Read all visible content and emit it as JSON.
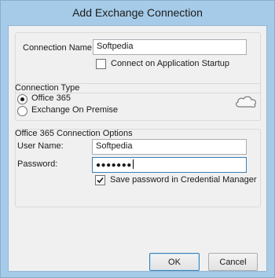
{
  "window": {
    "title": "Add Exchange Connection"
  },
  "connection": {
    "name_label": "Connection Name:",
    "name_value": "Softpedia",
    "startup_label": "Connect on Application Startup",
    "startup_checked": false
  },
  "connection_type": {
    "legend": "Connection Type",
    "options": [
      {
        "label": "Office 365",
        "selected": true
      },
      {
        "label": "Exchange On Premise",
        "selected": false
      }
    ],
    "icon": "cloud-icon"
  },
  "office365": {
    "legend": "Office 365 Connection Options",
    "username_label": "User Name:",
    "username_value": "Softpedia",
    "password_label": "Password:",
    "password_value": "●●●●●●●",
    "save_password_label": "Save password in Credential Manager",
    "save_password_checked": true
  },
  "buttons": {
    "ok": "OK",
    "cancel": "Cancel"
  }
}
